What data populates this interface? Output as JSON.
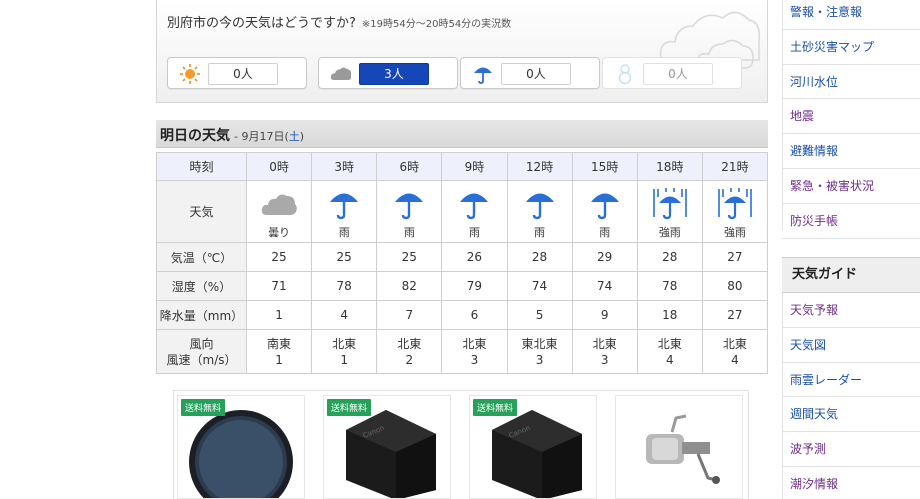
{
  "survey": {
    "question": "別府市の今の天気はどうですか?",
    "note": "※19時54分～20時54分の実況数",
    "options": [
      {
        "icon": "sun-icon",
        "count": "0人",
        "active": false
      },
      {
        "icon": "cloud-icon",
        "count": "3人",
        "active": true
      },
      {
        "icon": "umbrella-icon",
        "count": "0人",
        "active": false
      },
      {
        "icon": "snowman-icon",
        "count": "0人",
        "active": false
      }
    ]
  },
  "forecast": {
    "title": "明日の天気",
    "date_prefix": "- 9月17日(",
    "weekday": "土",
    "date_suffix": ")",
    "row_labels": {
      "time": "時刻",
      "weather": "天気",
      "temp": "気温（℃）",
      "humidity": "湿度（%）",
      "precip": "降水量（mm）",
      "wind_dir": "風向",
      "wind_speed": "風速（m/s）"
    },
    "hours": [
      "0時",
      "3時",
      "6時",
      "9時",
      "12時",
      "15時",
      "18時",
      "21時"
    ],
    "weather": [
      {
        "icon": "cloud-icon",
        "label": "曇り"
      },
      {
        "icon": "umbrella-icon",
        "label": "雨"
      },
      {
        "icon": "umbrella-icon",
        "label": "雨"
      },
      {
        "icon": "umbrella-icon",
        "label": "雨"
      },
      {
        "icon": "umbrella-icon",
        "label": "雨"
      },
      {
        "icon": "umbrella-icon",
        "label": "雨"
      },
      {
        "icon": "heavy-rain-umbrella-icon",
        "label": "強雨"
      },
      {
        "icon": "heavy-rain-umbrella-icon",
        "label": "強雨"
      }
    ],
    "temp": [
      "25",
      "25",
      "25",
      "26",
      "28",
      "29",
      "28",
      "27"
    ],
    "humidity": [
      "71",
      "78",
      "82",
      "79",
      "74",
      "74",
      "78",
      "80"
    ],
    "precip": [
      "1",
      "4",
      "7",
      "6",
      "5",
      "9",
      "18",
      "27"
    ],
    "wind_dir": [
      "南東",
      "北東",
      "北東",
      "北東",
      "東北東",
      "北東",
      "北東",
      "北東"
    ],
    "wind_speed": [
      "1",
      "1",
      "2",
      "3",
      "3",
      "3",
      "4",
      "4"
    ]
  },
  "products": [
    {
      "badge": "送料無料",
      "image": "lens-filter"
    },
    {
      "badge": "送料無料",
      "image": "camera-battery"
    },
    {
      "badge": "送料無料",
      "image": "camera-battery"
    },
    {
      "badge": "",
      "image": "fishing-reel"
    }
  ],
  "sidebar": {
    "top_items": [
      {
        "label": "警報・注意報",
        "color": "blue"
      },
      {
        "label": "土砂災害マップ",
        "color": "blue"
      },
      {
        "label": "河川水位",
        "color": "blue"
      },
      {
        "label": "地震",
        "color": "purple"
      },
      {
        "label": "避難情報",
        "color": "blue"
      },
      {
        "label": "緊急・被害状況",
        "color": "purple"
      },
      {
        "label": "防災手帳",
        "color": "purple"
      }
    ],
    "guide_header": "天気ガイド",
    "guide_items": [
      {
        "label": "天気予報",
        "color": "purple"
      },
      {
        "label": "天気図",
        "color": "blue"
      },
      {
        "label": "雨雲レーダー",
        "color": "blue"
      },
      {
        "label": "週間天気",
        "color": "blue"
      },
      {
        "label": "波予測",
        "color": "purple"
      },
      {
        "label": "潮汐情報",
        "color": "purple"
      }
    ]
  },
  "colors": {
    "accent_blue": "#1547b8",
    "umbrella_blue": "#2a6fd6",
    "badge_green": "#26a15a"
  }
}
